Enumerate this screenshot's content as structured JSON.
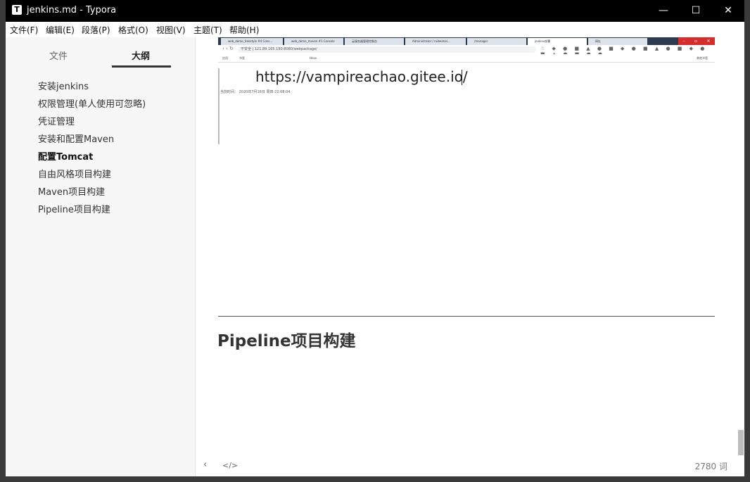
{
  "window": {
    "app_icon": "T",
    "title": "jenkins.md - Typora",
    "controls": {
      "minimize": "—",
      "maximize": "☐",
      "close": "✕"
    }
  },
  "menu": [
    "文件(F)",
    "编辑(E)",
    "段落(P)",
    "格式(O)",
    "视图(V)",
    "主题(T)",
    "帮助(H)"
  ],
  "sidebar": {
    "tabs": [
      "文件",
      "大纲"
    ],
    "active_tab": "大纲",
    "outline": [
      "安装jenkins",
      "权限管理(单人使用可忽略)",
      "凭证管理",
      "安装和配置Maven",
      "配置Tomcat",
      "自由风格项目构建",
      "Maven项目构建",
      "Pipeline项目构建"
    ],
    "active_item": "配置Tomcat"
  },
  "editor": {
    "screenshot": {
      "tabs": [
        "web_demo_freestyle #4 Cons...",
        "web_demo_maven #1 Console",
        "云服务器管理控制台",
        "Administrator / ruibeimei...",
        "/manager",
        "jenkins部署",
        "网址"
      ],
      "active_tab": "jenkins部署",
      "url": "不安全 | 121.89.165.190:8080/webpackage/",
      "bookmarks": [
        "应用",
        "书签",
        "Hexo"
      ],
      "other_bookmarks": "其他书签",
      "page_url": "https://vampireachao.gitee.io/",
      "deploy_time": "当前时间： 2020年7月16日 周四 22:08:04"
    },
    "heading": "Pipeline项目构建"
  },
  "footer": {
    "back_icon": "‹",
    "source_icon": "</>",
    "word_count": "2780 词"
  }
}
